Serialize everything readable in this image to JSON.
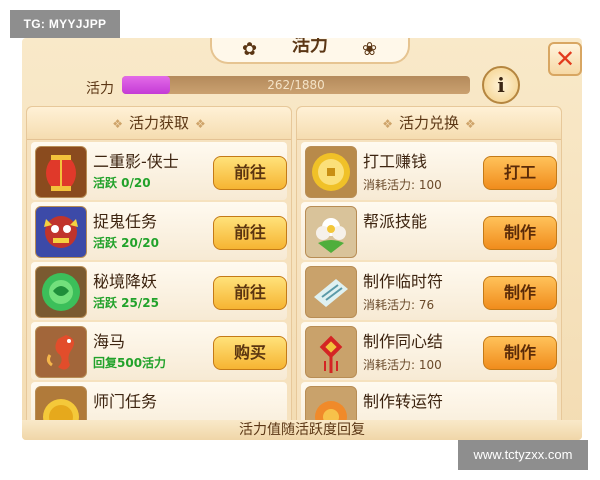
{
  "watermark_top_left": "TG: MYYJJPP",
  "watermark_bottom_right": "www.tctyzxx.com",
  "window": {
    "title": "活力",
    "close_symbol": "✕"
  },
  "vitality": {
    "label": "活力",
    "current": 262,
    "max": 1880,
    "display": "262/1880",
    "progress_fraction": 0.139
  },
  "info_button": {
    "symbol": "i"
  },
  "left_column": {
    "title": "活力获取",
    "items": [
      {
        "name": "二重影-侠士",
        "status": "活跃 0/20",
        "button": "前往",
        "icon": "lantern-icon"
      },
      {
        "name": "捉鬼任务",
        "status": "活跃 20/20",
        "button": "前往",
        "icon": "ghost-mask-icon"
      },
      {
        "name": "秘境降妖",
        "status": "活跃 25/25",
        "button": "前往",
        "icon": "green-orb-icon"
      },
      {
        "name": "海马",
        "status": "回复500活力",
        "button": "购买",
        "icon": "seahorse-icon"
      },
      {
        "name": "师门任务",
        "status": "",
        "button": "",
        "icon": "gold-medal-icon"
      }
    ]
  },
  "right_column": {
    "title": "活力兑换",
    "items": [
      {
        "name": "打工赚钱",
        "cost": "消耗活力: 100",
        "button": "打工",
        "icon": "gold-coin-icon"
      },
      {
        "name": "帮派技能",
        "cost": "",
        "button": "制作",
        "icon": "flower-icon"
      },
      {
        "name": "制作临时符",
        "cost": "消耗活力: 76",
        "button": "制作",
        "icon": "talisman-paper-icon"
      },
      {
        "name": "制作同心结",
        "cost": "消耗活力: 100",
        "button": "制作",
        "icon": "chinese-knot-icon"
      },
      {
        "name": "制作转运符",
        "cost": "",
        "button": "制作",
        "icon": "fortune-charm-icon"
      }
    ]
  },
  "footer_note": "活力值随活跃度回复",
  "colors": {
    "accent_purple": "#d14fe0",
    "status_green": "#22a22b",
    "button_yellow": "#f6b432",
    "button_orange": "#f08c1c"
  }
}
